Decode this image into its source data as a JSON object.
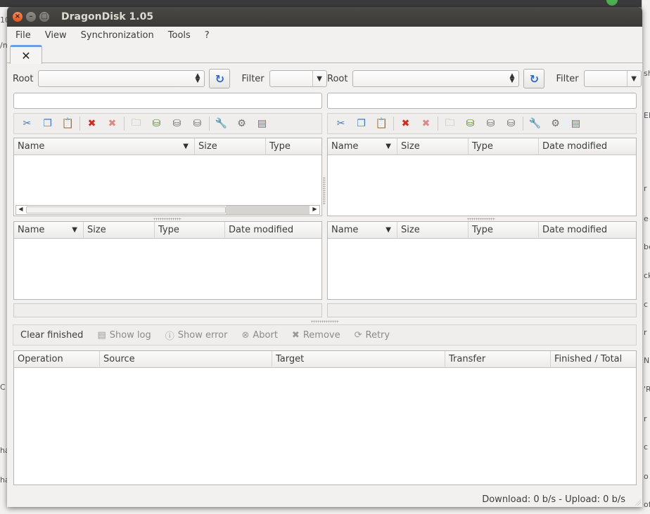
{
  "window": {
    "title": "DragonDisk 1.05"
  },
  "menu": [
    "File",
    "View",
    "Synchronization",
    "Tools",
    "?"
  ],
  "tab": {
    "close_glyph": "✕"
  },
  "panes": {
    "left": {
      "root_label": "Root",
      "root_value": "",
      "filter_label": "Filter",
      "filter_value": "",
      "path_value": "",
      "folder_columns": [
        "Name",
        "Size",
        "Type"
      ],
      "file_columns": [
        "Name",
        "Size",
        "Type",
        "Date modified"
      ]
    },
    "right": {
      "root_label": "Root",
      "root_value": "",
      "filter_label": "Filter",
      "filter_value": "",
      "path_value": "",
      "folder_columns": [
        "Name",
        "Size",
        "Type",
        "Date modified"
      ],
      "file_columns": [
        "Name",
        "Size",
        "Type",
        "Date modified"
      ]
    }
  },
  "toolbar_icons": [
    "cut-icon",
    "copy-icon",
    "paste-icon",
    "delete-icon",
    "delete-all-icon",
    "new-folder-icon",
    "add-bucket-icon",
    "bucket-icon",
    "bucket-properties-icon",
    "properties-icon",
    "settings-icon",
    "view-menu-icon"
  ],
  "queue": {
    "buttons": {
      "clear_finished": "Clear finished",
      "show_log": "Show log",
      "show_error": "Show error",
      "abort": "Abort",
      "remove": "Remove",
      "retry": "Retry"
    },
    "columns": [
      "Operation",
      "Source",
      "Target",
      "Transfer",
      "Finished / Total"
    ]
  },
  "status": {
    "text": "Download: 0 b/s - Upload: 0 b/s"
  },
  "colors": {
    "titlebar": "#3b3a36",
    "close": "#e2561d",
    "accent": "#6aa0e0",
    "refresh": "#2c6bc9",
    "delete": "#d12a1e"
  },
  "background": {
    "left_fragments": [
      "10",
      "/n",
      "C",
      "ha",
      "ha"
    ],
    "right_fragments": [
      "sh",
      "ED",
      "r",
      "e p",
      "be",
      "ck",
      "c",
      "r",
      "N",
      "'R",
      "r",
      "c",
      "o",
      "of"
    ]
  }
}
